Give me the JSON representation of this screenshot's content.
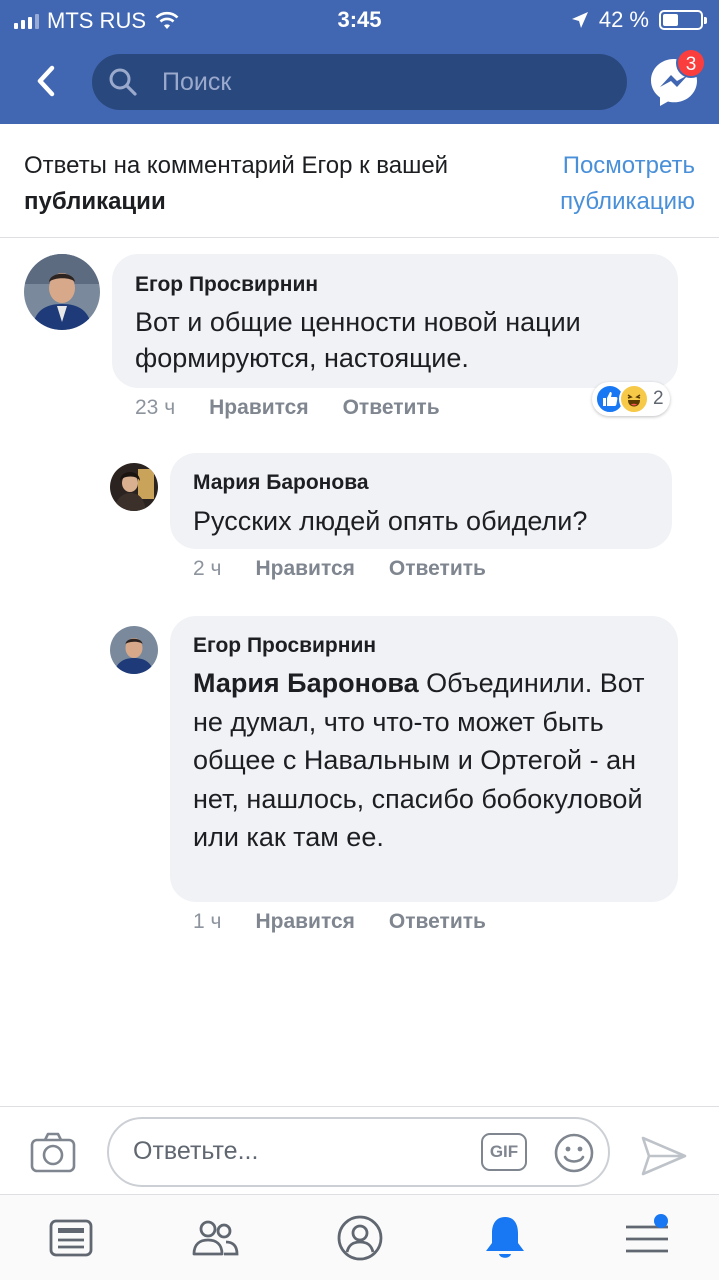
{
  "status_bar": {
    "carrier": "MTS RUS",
    "time": "3:45",
    "battery": "42 %",
    "battery_level": 0.42
  },
  "nav": {
    "search_placeholder": "Поиск",
    "messenger_badge": "3"
  },
  "context": {
    "message_prefix": "Ответы на комментарий Егор к вашей",
    "message_bold": "публикации",
    "view_post_link": "Посмотреть публикацию"
  },
  "comments": [
    {
      "author": "Егор Просвирнин",
      "text": "Вот и общие ценности новой нации формируются, настоящие.",
      "time": "23 ч",
      "like": "Нравится",
      "reply": "Ответить",
      "reaction_count": "2",
      "reaction_icons": [
        "like-icon",
        "haha-icon"
      ]
    },
    {
      "author": "Мария Баронова",
      "text": "Русских людей опять обидели?",
      "time": "2 ч",
      "like": "Нравится",
      "reply": "Ответить"
    },
    {
      "author": "Егор Просвирнин",
      "mention": "Мария Баронова",
      "text": "Объединили. Вот не думал, что что-то может быть общее с Навальным и Ортегой - ан нет, нашлось, спасибо бобокуловой или как там ее.",
      "time": "1 ч",
      "like": "Нравится",
      "reply": "Ответить"
    }
  ],
  "composer": {
    "placeholder": "Ответьте...",
    "gif_label": "GIF"
  },
  "tabs": [
    "news-feed-icon",
    "friends-icon",
    "profile-icon",
    "notifications-icon",
    "menu-icon"
  ],
  "colors": {
    "brand": "#4267b2",
    "link": "#4a90d9",
    "bubble": "#f0f2f5",
    "badge": "#fa3e3e",
    "active_tab": "#1877f2"
  }
}
